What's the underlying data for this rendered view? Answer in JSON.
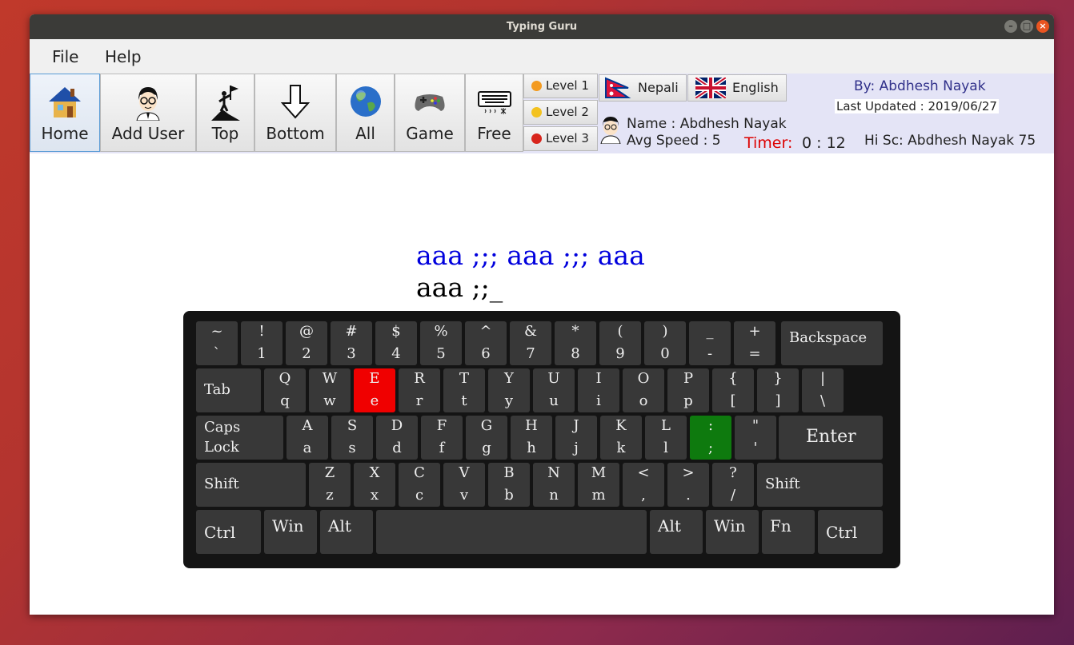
{
  "window": {
    "title": "Typing Guru"
  },
  "menu": {
    "file": "File",
    "help": "Help"
  },
  "toolbar": {
    "home": "Home",
    "add_user": "Add User",
    "top": "Top",
    "bottom": "Bottom",
    "all": "All",
    "game": "Game",
    "free": "Free"
  },
  "levels": [
    "Level 1",
    "Level 2",
    "Level 3"
  ],
  "languages": {
    "nepali": "Nepali",
    "english": "English"
  },
  "info": {
    "by": "By: Abdhesh Nayak",
    "updated": "Last Updated : 2019/06/27",
    "name": "Name : Abdhesh Nayak",
    "speed": "Avg Speed : 5",
    "timer_label": "Timer:",
    "timer_value": "0 : 12",
    "hiscore": "Hi Sc:  Abdhesh Nayak 75"
  },
  "typing": {
    "target": "aaa ;;; aaa ;;; aaa",
    "typed": "aaa ;;_"
  },
  "keyboard": {
    "row1": [
      [
        "~",
        "`"
      ],
      [
        "!",
        "1"
      ],
      [
        "@",
        "2"
      ],
      [
        "#",
        "3"
      ],
      [
        "$",
        "4"
      ],
      [
        "%",
        "5"
      ],
      [
        "^",
        "6"
      ],
      [
        "&",
        "7"
      ],
      [
        "*",
        "8"
      ],
      [
        "(",
        "9"
      ],
      [
        ")",
        "0"
      ],
      [
        "_",
        "-"
      ],
      [
        "+",
        "="
      ]
    ],
    "row2": [
      [
        "Q",
        "q"
      ],
      [
        "W",
        "w"
      ],
      [
        "E",
        "e"
      ],
      [
        "R",
        "r"
      ],
      [
        "T",
        "t"
      ],
      [
        "Y",
        "y"
      ],
      [
        "U",
        "u"
      ],
      [
        "I",
        "i"
      ],
      [
        "O",
        "o"
      ],
      [
        "P",
        "p"
      ],
      [
        "{",
        "["
      ],
      [
        "}",
        "]"
      ],
      [
        "|",
        "\\"
      ]
    ],
    "row3": [
      [
        "A",
        "a"
      ],
      [
        "S",
        "s"
      ],
      [
        "D",
        "d"
      ],
      [
        "F",
        "f"
      ],
      [
        "G",
        "g"
      ],
      [
        "H",
        "h"
      ],
      [
        "J",
        "j"
      ],
      [
        "K",
        "k"
      ],
      [
        "L",
        "l"
      ],
      [
        ":",
        ";"
      ],
      [
        "\"",
        "'"
      ]
    ],
    "row4": [
      [
        "Z",
        "z"
      ],
      [
        "X",
        "x"
      ],
      [
        "C",
        "c"
      ],
      [
        "V",
        "v"
      ],
      [
        "B",
        "b"
      ],
      [
        "N",
        "n"
      ],
      [
        "M",
        "m"
      ],
      [
        "<",
        ","
      ],
      [
        ">",
        "."
      ],
      [
        "?",
        "/"
      ]
    ],
    "backspace": "Backspace",
    "tab": "Tab",
    "caps": "Caps\nLock",
    "enter": "Enter",
    "shift_left": "Shift",
    "shift_right": "Shift",
    "ctrl_left": "Ctrl",
    "win_left": "Win",
    "alt_left": "Alt",
    "alt_right": "Alt",
    "win_right": "Win",
    "fn": "Fn",
    "ctrl_right": "Ctrl",
    "wrong_key": "E",
    "next_key": ":",
    "colors": {
      "wrong": "#f00000",
      "next": "#0e7a0e",
      "target_text": "#0000dd",
      "timer": "#dd0000"
    }
  }
}
